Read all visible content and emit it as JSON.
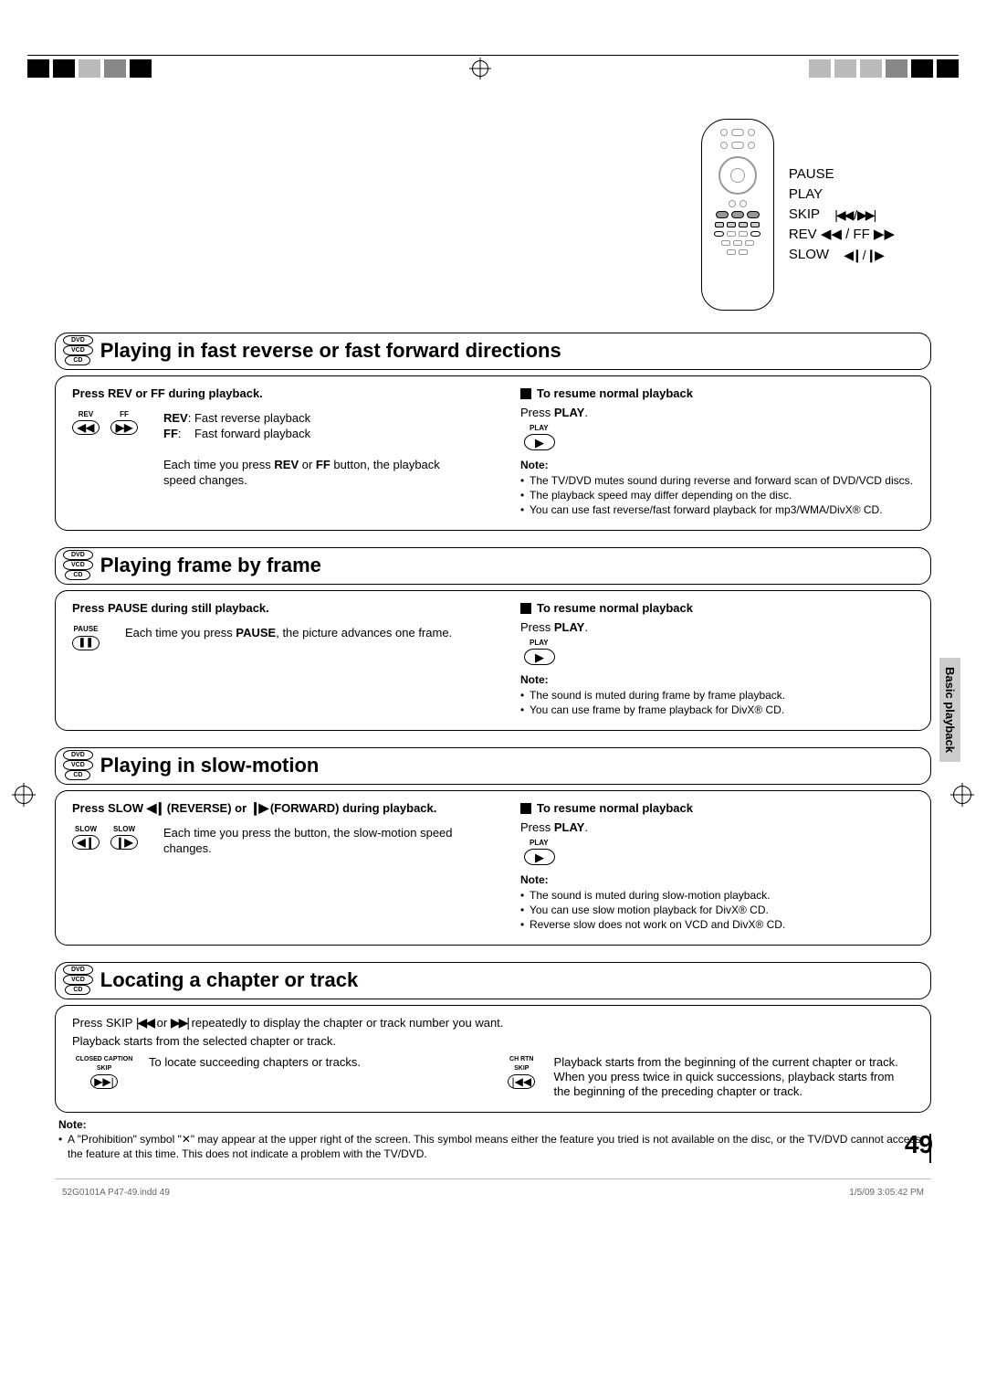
{
  "remote_labels": {
    "pause": "PAUSE",
    "play": "PLAY",
    "skip": "SKIP",
    "skip_glyph": "|◀◀ / ▶▶|",
    "rev_ff": "REV ◀◀ / FF ▶▶",
    "slow": "SLOW",
    "slow_glyph": "◀❙ / ❙▶"
  },
  "disc_labels": {
    "dvd": "DVD",
    "vcd": "VCD",
    "cd": "CD"
  },
  "sections": {
    "s1": {
      "title": "Playing in fast reverse or fast forward directions",
      "left_lead": "Press REV or FF during playback.",
      "btn_rev_label": "REV",
      "btn_ff_label": "FF",
      "btn_rev_glyph": "◀◀",
      "btn_ff_glyph": "▶▶",
      "rev_def": "Fast reverse playback",
      "ff_def": "Fast forward playback",
      "left_para1": "Each time you press ",
      "left_para_bold1": "REV",
      "left_para_mid": " or ",
      "left_para_bold2": "FF",
      "left_para2": " button, the playback speed changes.",
      "right_subhead": "To resume normal playback",
      "right_line": "Press ",
      "right_line_bold": "PLAY",
      "right_line_end": ".",
      "play_label": "PLAY",
      "play_glyph": "▶",
      "note_label": "Note:",
      "notes": [
        "The TV/DVD mutes sound during reverse and forward scan of DVD/VCD discs.",
        "The playback speed may differ depending on the disc.",
        "You can use fast reverse/fast forward playback for mp3/WMA/DivX® CD."
      ]
    },
    "s2": {
      "title": "Playing frame by frame",
      "left_lead": "Press PAUSE during still playback.",
      "btn_pause_label": "PAUSE",
      "btn_pause_glyph": "❚❚",
      "left_para1": "Each time you press ",
      "left_para_bold": "PAUSE",
      "left_para2": ", the picture advances one frame.",
      "right_subhead": "To resume normal playback",
      "right_line": "Press ",
      "right_line_bold": "PLAY",
      "right_line_end": ".",
      "play_label": "PLAY",
      "play_glyph": "▶",
      "note_label": "Note:",
      "notes": [
        "The sound is muted during frame by frame playback.",
        "You can use frame by frame playback for DivX® CD."
      ]
    },
    "s3": {
      "title": "Playing in slow-motion",
      "left_lead_1": "Press SLOW ",
      "left_lead_glyph_rev": "◀❙",
      "left_lead_rev": " (REVERSE) or ",
      "left_lead_glyph_fwd": "❙▶",
      "left_lead_fwd": " (FORWARD) during playback.",
      "btn_slow_label": "SLOW",
      "btn_slow_rev_glyph": "◀❙",
      "btn_slow_fwd_glyph": "❙▶",
      "left_para": "Each time you press the button, the slow-motion speed changes.",
      "right_subhead": "To resume normal playback",
      "right_line": "Press ",
      "right_line_bold": "PLAY",
      "right_line_end": ".",
      "play_label": "PLAY",
      "play_glyph": "▶",
      "note_label": "Note:",
      "notes": [
        "The sound is muted during slow-motion playback.",
        "You can use slow motion playback for DivX® CD.",
        "Reverse slow does not work on VCD and DivX® CD."
      ]
    },
    "s4": {
      "title": "Locating a chapter or track",
      "lead_1": "Press SKIP ",
      "lead_g1": "|◀◀",
      "lead_mid": " or ",
      "lead_g2": "▶▶|",
      "lead_2": " repeatedly to display the chapter or track number you want.",
      "line2": "Playback starts from the selected chapter or track.",
      "btn_cc_label": "CLOSED CAPTION\nSKIP",
      "btn_cc_glyph": "▶▶|",
      "btn_cc_desc": "To locate succeeding chapters or tracks.",
      "btn_chrtn_label": "CH RTN\nSKIP",
      "btn_chrtn_glyph": "|◀◀",
      "btn_chrtn_desc1": "Playback starts from the beginning of the current chapter or track.",
      "btn_chrtn_desc2": "When you press twice in quick successions, playback starts from the beginning of the preceding chapter or track.",
      "note_label": "Note:",
      "note_text": "A \"Prohibition\" symbol \"✕\" may appear at the upper right of the screen. This symbol means either the feature you tried is not available on the disc, or the TV/DVD cannot access the feature at this time. This does not indicate a problem with the TV/DVD."
    }
  },
  "side_tab": "Basic playback",
  "page_number": "49",
  "footer_left": "52G0101A P47-49.indd   49",
  "footer_right": "1/5/09   3:05:42 PM"
}
